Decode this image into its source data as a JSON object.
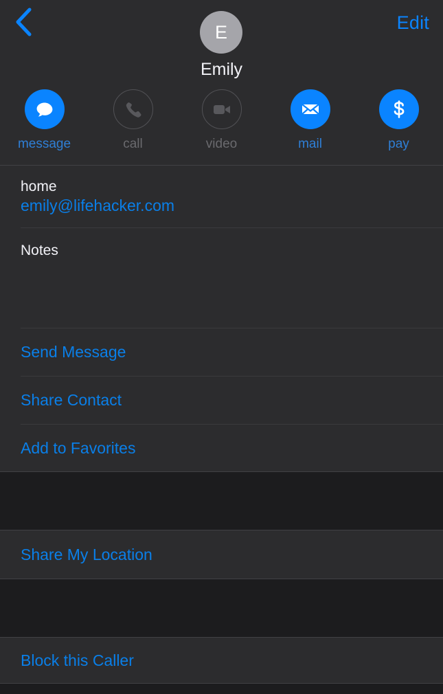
{
  "nav": {
    "back_icon": "chevron-left-icon",
    "edit_label": "Edit",
    "accent": "#0a84ff"
  },
  "header": {
    "avatar_initial": "E",
    "avatar_color": "#a5a5aa",
    "contact_name": "Emily"
  },
  "quick_actions": [
    {
      "id": "message",
      "label": "message",
      "icon": "message-bubble-icon",
      "enabled": true
    },
    {
      "id": "call",
      "label": "call",
      "icon": "phone-icon",
      "enabled": false
    },
    {
      "id": "video",
      "label": "video",
      "icon": "video-camera-icon",
      "enabled": false
    },
    {
      "id": "mail",
      "label": "mail",
      "icon": "envelope-icon",
      "enabled": true
    },
    {
      "id": "pay",
      "label": "pay",
      "icon": "dollar-sign-icon",
      "enabled": true
    }
  ],
  "fields": {
    "email_label": "home",
    "email_value": "emily@lifehacker.com",
    "notes_label": "Notes",
    "notes_value": ""
  },
  "actions": {
    "send_message": "Send Message",
    "share_contact": "Share Contact",
    "add_to_favorites": "Add to Favorites",
    "share_my_location": "Share My Location",
    "block_this_caller": "Block this Caller"
  },
  "colors": {
    "background": "#2c2c2e",
    "gap_background": "#1c1c1e",
    "link": "#0a7fe8",
    "separator": "#3a3a3d",
    "disabled": "#6a6a6e"
  }
}
